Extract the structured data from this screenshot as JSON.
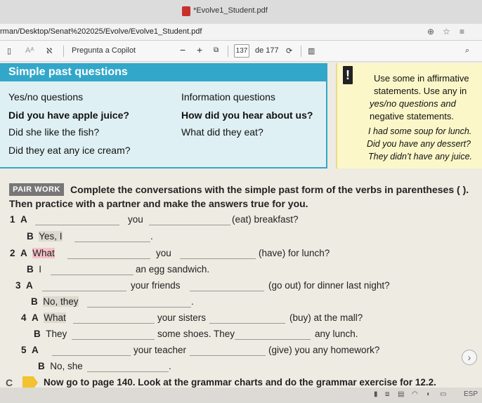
{
  "window": {
    "title": "*Evolve1_Student.pdf"
  },
  "address": {
    "url": "rman/Desktop/Senat%202025/Evolve/Evolve1_Student.pdf"
  },
  "pdf_toolbar": {
    "ask_copilot": "Pregunta a Copilot",
    "minus": "−",
    "plus": "+",
    "page_current": "137",
    "page_of": "de 177"
  },
  "grammar": {
    "title": "Simple past questions",
    "col1_header": "Yes/no questions",
    "col2_header": "Information questions",
    "col1": [
      "Did you have apple juice?",
      "Did she like the fish?",
      "Did they eat any ice cream?"
    ],
    "col2": [
      "How did you hear about us?",
      "What did they eat?"
    ],
    "note": {
      "line1": "Use some in affirmative",
      "line2": "statements. Use any in",
      "line3": "yes/no questions and",
      "line4": "negative statements.",
      "ex1": "I had some soup for lunch.",
      "ex2": "Did you have any dessert?",
      "ex3": "They didn’t have any juice."
    }
  },
  "exercise": {
    "badge": "PAIR WORK",
    "instruction_line1": "Complete the conversations with the simple past form of the verbs in parentheses ( ).",
    "instruction_line2": "Then practice with a partner and make the answers true for you.",
    "items": [
      {
        "n": "1",
        "speaker": "A",
        "a": "",
        "b": "you",
        "c": "(eat) breakfast?"
      },
      {
        "n": "",
        "speaker": "B",
        "a": "Yes, I",
        "b": "",
        "c": "."
      },
      {
        "n": "2",
        "speaker": "A",
        "a": "What",
        "b": "you",
        "c": "(have) for lunch?"
      },
      {
        "n": "",
        "speaker": "B",
        "a": "I",
        "b": "an egg sandwich.",
        "c": ""
      },
      {
        "n": "3",
        "speaker": "A",
        "a": "",
        "b": "your friends",
        "c": "(go out) for dinner last night?"
      },
      {
        "n": "",
        "speaker": "B",
        "a": "No, they",
        "b": "",
        "c": "."
      },
      {
        "n": "4",
        "speaker": "A",
        "a": "What",
        "b": "your sisters",
        "c": "(buy) at the mall?"
      },
      {
        "n": "",
        "speaker": "B",
        "a": "They",
        "b": "some shoes. They",
        "c": "any lunch."
      },
      {
        "n": "5",
        "speaker": "A",
        "a": "",
        "b": "your teacher",
        "c": "(give) you any homework?"
      },
      {
        "n": "",
        "speaker": "B",
        "a": "No, she",
        "b": "",
        "c": "."
      }
    ],
    "section_c_letter": "C",
    "section_c_text": "Now go to page 140. Look at the grammar charts and do the grammar exercise for 12.2."
  },
  "tray": {
    "lang": "ESP"
  },
  "colors": {
    "accent": "#33a7c9",
    "note_bg": "#fbf7c8",
    "highlight_pink": "#f4c2c7"
  }
}
